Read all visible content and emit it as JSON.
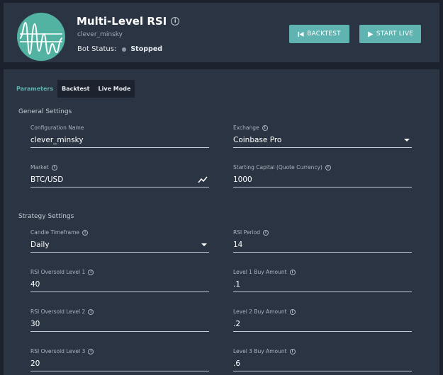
{
  "header": {
    "bot_name": "Multi-Level RSI",
    "username": "clever_minsky",
    "status_label": "Bot Status:",
    "status_value": "Stopped",
    "backtest_button": "BACKTEST",
    "start_live_button": "START LIVE"
  },
  "tabs": [
    {
      "label": "Parameters",
      "active": true
    },
    {
      "label": "Backtest",
      "active": false
    },
    {
      "label": "Live Mode",
      "active": false
    }
  ],
  "general_settings": {
    "title": "General Settings",
    "configuration_name": {
      "label": "Configuration Name",
      "value": "clever_minsky"
    },
    "exchange": {
      "label": "Exchange",
      "value": "Coinbase Pro"
    },
    "market": {
      "label": "Market",
      "value": "BTC/USD"
    },
    "starting_capital": {
      "label": "Starting Capital (Quote Currency)",
      "value": "1000"
    }
  },
  "strategy_settings": {
    "title": "Strategy Settings",
    "candle_timeframe": {
      "label": "Candle Timeframe",
      "value": "Daily"
    },
    "rsi_period": {
      "label": "RSI Period",
      "value": "14"
    },
    "rsi_oversold_1": {
      "label": "RSI Oversold Level 1",
      "value": "40"
    },
    "level1_buy": {
      "label": "Level 1 Buy Amount",
      "value": ".1"
    },
    "rsi_oversold_2": {
      "label": "RSI Oversold Level 2",
      "value": "30"
    },
    "level2_buy": {
      "label": "Level 2 Buy Amount",
      "value": ".2"
    },
    "rsi_oversold_3": {
      "label": "RSI Oversold Level 3",
      "value": "20"
    },
    "level3_buy": {
      "label": "Level 3 Buy Amount",
      "value": ".6"
    }
  },
  "colors": {
    "background": "#1c222d",
    "panel": "#2b3442",
    "accent": "#5fb3b0",
    "logo": "#52b3a3",
    "status_dot": "#8f98a4"
  },
  "icons": {
    "info": "info-icon",
    "backtest": "skip-back-icon",
    "start_live": "play-icon",
    "market": "trend-chart-icon",
    "dropdown": "caret-down-icon"
  }
}
